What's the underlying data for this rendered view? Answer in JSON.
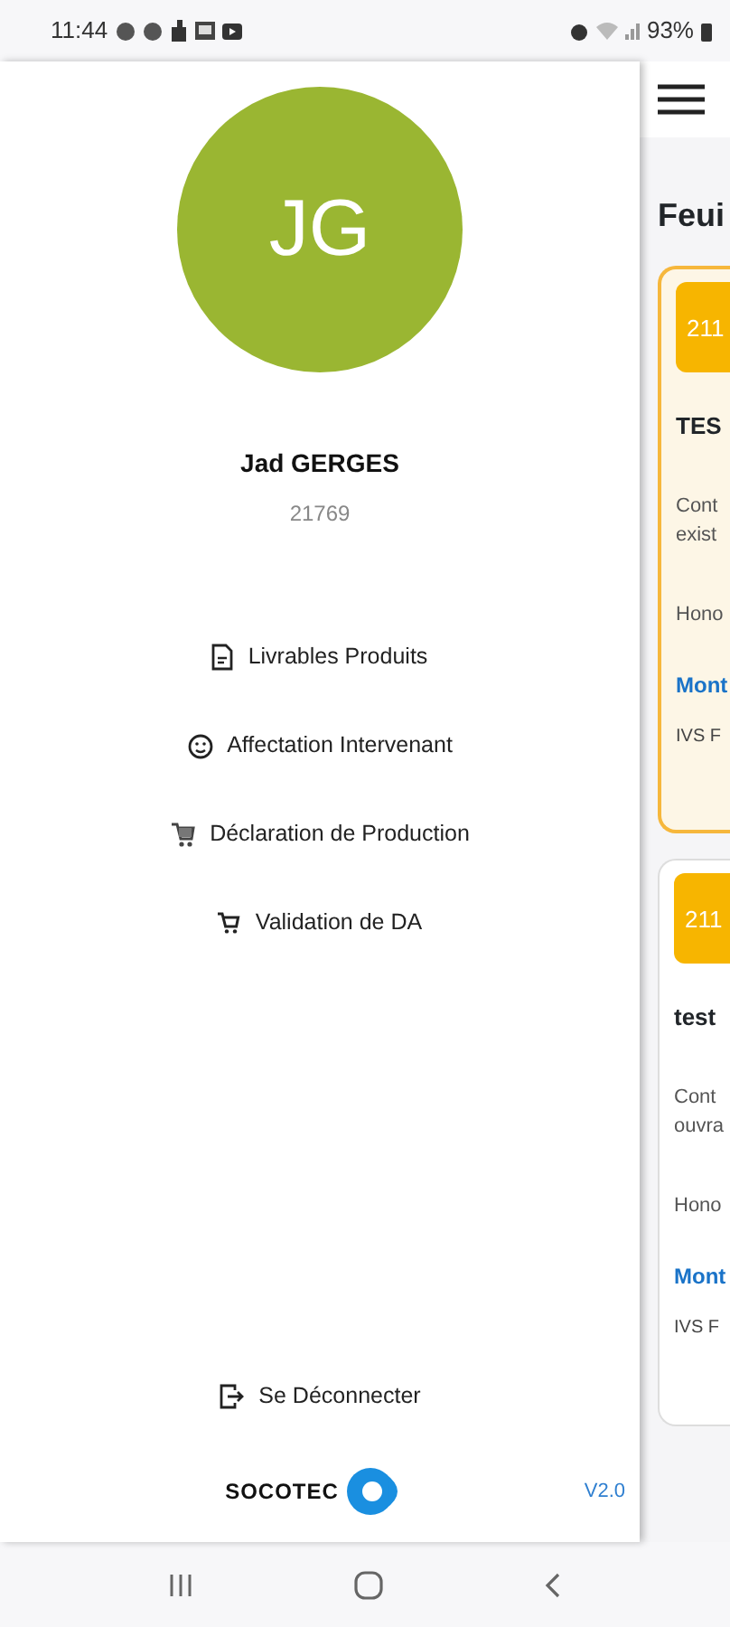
{
  "status_bar": {
    "time": "11:44",
    "battery": "93%"
  },
  "drawer": {
    "avatar_initials": "JG",
    "user_name": "Jad GERGES",
    "user_id": "21769",
    "menu": [
      {
        "label": "Livrables Produits",
        "kind": "document"
      },
      {
        "label": "Affectation Intervenant",
        "kind": "smiley"
      },
      {
        "label": "Déclaration de Production",
        "kind": "cart-building"
      },
      {
        "label": "Validation de DA",
        "kind": "cart"
      }
    ],
    "logout": "Se Déconnecter",
    "logo": "SOCOTEC",
    "version": "V2.0"
  },
  "background_page": {
    "title": "Feui",
    "cards": [
      {
        "badge": "211",
        "title": "TES",
        "line_1": "Cont",
        "line_2": "exist",
        "label": "Hono",
        "link": "Mont",
        "footer": "IVS F",
        "highlighted": true
      },
      {
        "badge": "211",
        "title": "test",
        "line_1": "Cont",
        "line_2": "ouvra",
        "label": "Hono",
        "link": "Mont",
        "footer": "IVS F",
        "highlighted": false
      }
    ]
  }
}
